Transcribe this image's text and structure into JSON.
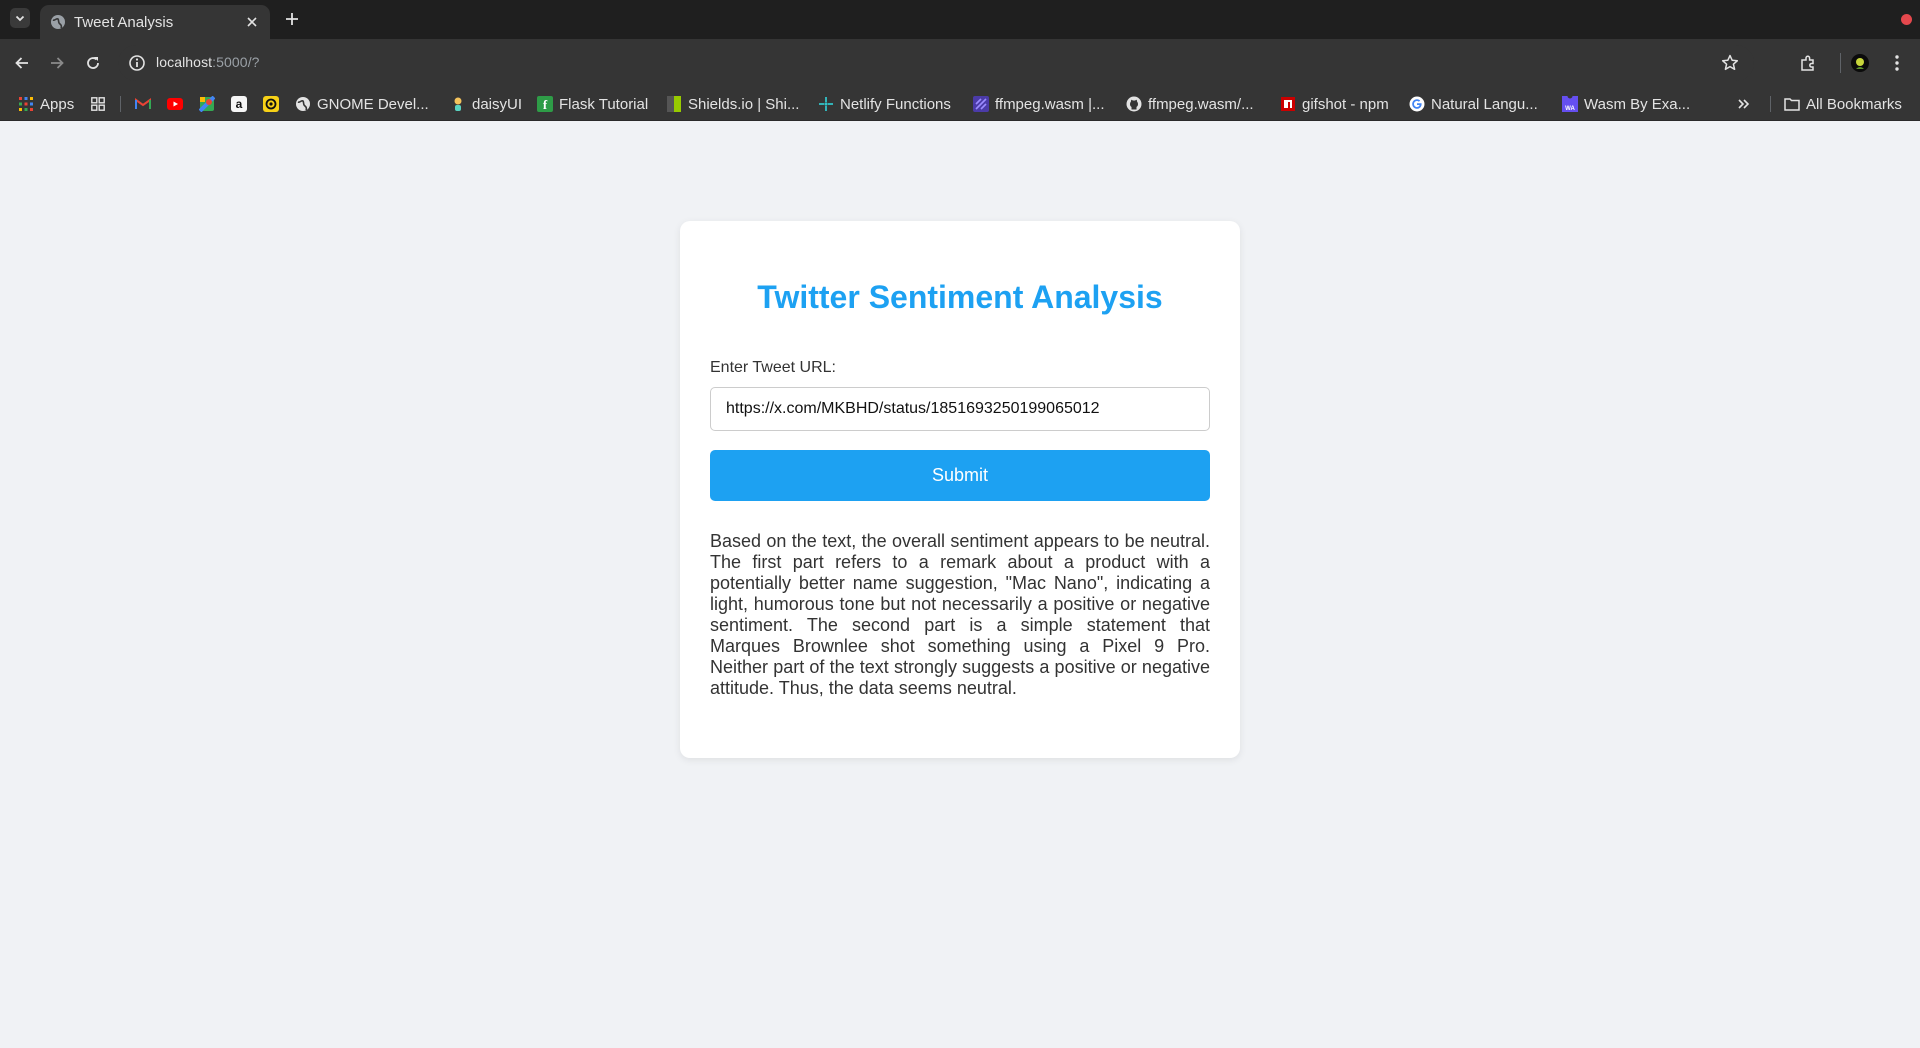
{
  "browser": {
    "tab_title": "Tweet Analysis",
    "url_host": "localhost",
    "url_rest": ":5000/?",
    "bookmarks": [
      {
        "label": "Apps",
        "icon": "apps-grid-icon"
      },
      {
        "label": "",
        "icon": "tab-groups-icon"
      },
      {
        "label": "",
        "icon": "gmail-icon"
      },
      {
        "label": "",
        "icon": "youtube-icon"
      },
      {
        "label": "",
        "icon": "maps-icon"
      },
      {
        "label": "",
        "icon": "amazon-icon"
      },
      {
        "label": "",
        "icon": "bookmark-app-icon"
      },
      {
        "label": "GNOME Devel...",
        "icon": "globe-icon"
      },
      {
        "label": "daisyUI",
        "icon": "daisyui-icon"
      },
      {
        "label": "Flask Tutorial",
        "icon": "flask-icon"
      },
      {
        "label": "Shields.io | Shi...",
        "icon": "shields-icon"
      },
      {
        "label": "Netlify Functions",
        "icon": "netlify-icon"
      },
      {
        "label": "ffmpeg.wasm |...",
        "icon": "ffmpeg-icon"
      },
      {
        "label": "ffmpeg.wasm/...",
        "icon": "github-icon"
      },
      {
        "label": "gifshot - npm",
        "icon": "npm-icon"
      },
      {
        "label": "Natural Langu...",
        "icon": "google-icon"
      },
      {
        "label": "Wasm By Exa...",
        "icon": "wasm-icon"
      }
    ],
    "all_bookmarks": "All Bookmarks"
  },
  "page": {
    "title": "Twitter Sentiment Analysis",
    "input_label": "Enter Tweet URL:",
    "input_value": "https://x.com/MKBHD/status/1851693250199065012",
    "submit_label": "Submit",
    "result_text": "Based on the text, the overall sentiment appears to be neutral. The first part refers to a remark about a product with a potentially better name suggestion, \"Mac Nano\", indicating a light, humorous tone but not necessarily a positive or negative sentiment. The second part is a simple statement that Marques Brownlee shot something using a Pixel 9 Pro. Neither part of the text strongly suggests a positive or negative attitude. Thus, the data seems neutral."
  },
  "colors": {
    "accent": "#1da1f2",
    "page_bg": "#f0f2f5"
  }
}
